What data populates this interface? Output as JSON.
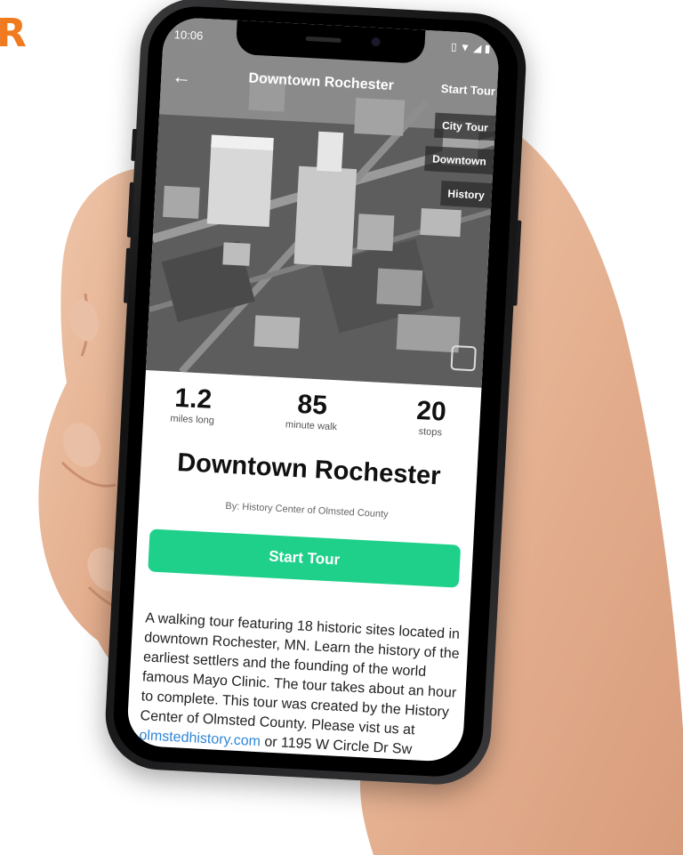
{
  "brand": {
    "line1": "RN",
    "line2": "R",
    "color": "#f07a1e"
  },
  "status_bar": {
    "time": "10:06",
    "icons": [
      "vibrate-icon",
      "wifi-icon",
      "signal-icon",
      "battery-icon"
    ]
  },
  "nav": {
    "back_icon": "arrow-left-icon",
    "title": "Downtown Rochester",
    "start_label": "Start Tour"
  },
  "tags": [
    "City Tour",
    "Downtown",
    "History"
  ],
  "share_icon": "share-icon",
  "stats": [
    {
      "value": "1.2",
      "label": "miles long"
    },
    {
      "value": "85",
      "label": "minute walk"
    },
    {
      "value": "20",
      "label": "stops"
    }
  ],
  "tour": {
    "title": "Downtown Rochester",
    "by": "By: History Center of Olmsted County",
    "button_label": "Start Tour",
    "description_before": "A walking tour featuring 18 historic sites located in downtown Rochester, MN. Learn the history of the earliest settlers and the founding of the world famous Mayo Clinic. The tour takes about an hour to complete. This tour was created by the History Center of Olmsted County. Please vist us at ",
    "description_link": "olmstedhistory.com",
    "description_after": " or 1195 W Circle Dr Sw"
  },
  "colors": {
    "accent": "#1fd08a",
    "link": "#2f86d9",
    "brand": "#f07a1e"
  }
}
